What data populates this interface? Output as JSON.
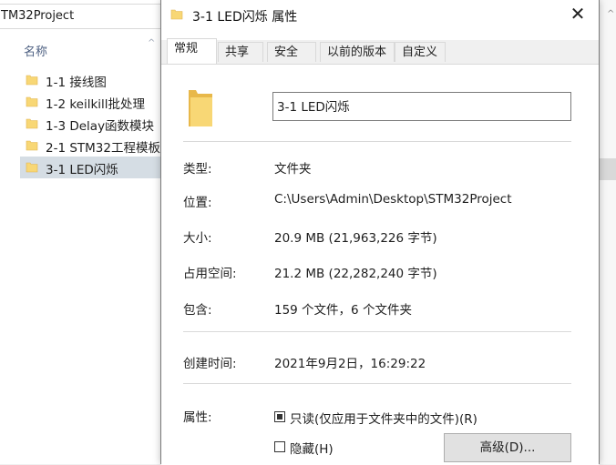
{
  "explorer": {
    "address": "TM32Project",
    "column_name": "名称",
    "files": [
      {
        "label": "1-1 接线图"
      },
      {
        "label": "1-2 keilkill批处理"
      },
      {
        "label": "1-3 Delay函数模块"
      },
      {
        "label": "2-1 STM32工程模板"
      },
      {
        "label": "3-1 LED闪烁",
        "selected": true
      }
    ]
  },
  "dialog": {
    "title": "3-1 LED闪烁 属性",
    "close_glyph": "✕",
    "tabs": [
      "常规",
      "共享",
      "安全",
      "以前的版本",
      "自定义"
    ],
    "active_tab": "常规",
    "general": {
      "name_value": "3-1 LED闪烁",
      "type_label": "类型:",
      "type_value": "文件夹",
      "location_label": "位置:",
      "location_value": "C:\\Users\\Admin\\Desktop\\STM32Project",
      "size_label": "大小:",
      "size_value": "20.9 MB (21,963,226 字节)",
      "disk_label": "占用空间:",
      "disk_value": "21.2 MB (22,282,240 字节)",
      "contains_label": "包含:",
      "contains_value": "159 个文件，6 个文件夹",
      "created_label": "创建时间:",
      "created_value": "2021年9月2日，16:29:22",
      "attributes_label": "属性:",
      "readonly_label": "只读(仅应用于文件夹中的文件)(R)",
      "readonly_checked": true,
      "hidden_label": "隐藏(H)",
      "hidden_checked": false,
      "advanced_button": "高级(D)..."
    }
  },
  "colors": {
    "folder": "#f8d775",
    "folder_dark": "#e8b84a",
    "selection": "#d9d9d9"
  },
  "icons": [
    "folder-icon",
    "close-icon",
    "chevron-up-icon",
    "checkbox-checked-icon",
    "checkbox-empty-icon"
  ]
}
